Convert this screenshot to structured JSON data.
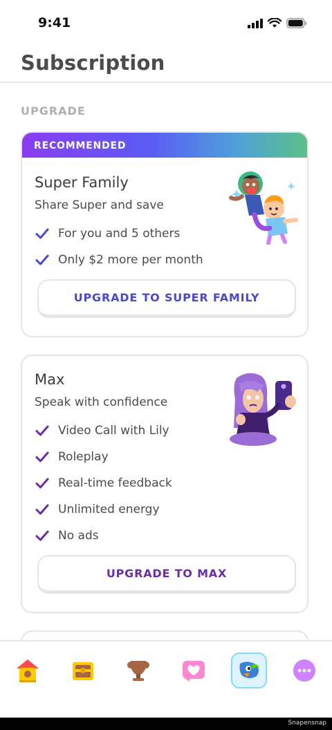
{
  "status_bar": {
    "time": "9:41"
  },
  "header": {
    "title": "Subscription"
  },
  "section": {
    "label": "UPGRADE"
  },
  "family_card": {
    "badge": "RECOMMENDED",
    "title": "Super Family",
    "subtitle": "Share Super and save",
    "features": [
      "For you and 5 others",
      "Only $2 more per month"
    ],
    "button": "UPGRADE TO SUPER FAMILY",
    "check_color": "#4a49c9"
  },
  "max_card": {
    "title": "Max",
    "subtitle": "Speak with confidence",
    "features": [
      "Video Call with Lily",
      "Roleplay",
      "Real-time feedback",
      "Unlimited energy",
      "No ads"
    ],
    "button": "UPGRADE TO MAX",
    "check_color": "#6a2ca8"
  },
  "tabbar": {
    "items": [
      {
        "icon": "home-icon",
        "active": false
      },
      {
        "icon": "treasure-chest-icon",
        "active": false
      },
      {
        "icon": "trophy-icon",
        "active": false
      },
      {
        "icon": "heart-icon",
        "active": false
      },
      {
        "icon": "bird-profile-icon",
        "active": true
      },
      {
        "icon": "more-icon",
        "active": false
      }
    ]
  },
  "footer": {
    "watermark": "Snapensnap"
  }
}
